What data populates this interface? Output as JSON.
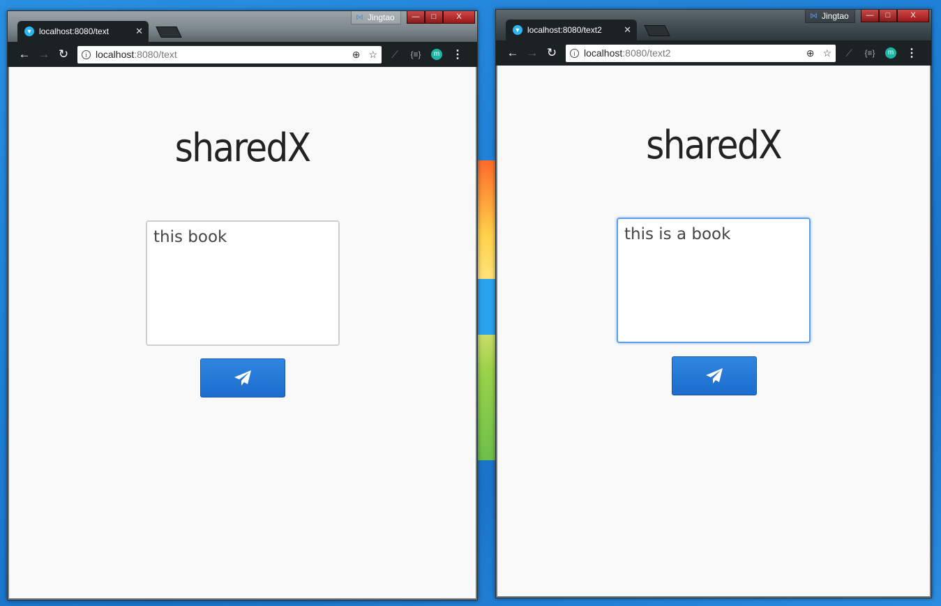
{
  "windows": [
    {
      "id": "left",
      "profile_name": "Jingtao",
      "tab_title": "localhost:8080/text",
      "url_host": "localhost",
      "url_path": ":8080/text",
      "brand_title": "sharedX",
      "textarea_value": "this book",
      "textarea_focused": false
    },
    {
      "id": "right",
      "profile_name": "Jingtao",
      "tab_title": "localhost:8080/text2",
      "url_host": "localhost",
      "url_path": ":8080/text2",
      "brand_title": "sharedX",
      "textarea_value": "this is a book",
      "textarea_focused": true
    }
  ],
  "icons": {
    "back": "back-arrow-icon",
    "forward": "forward-arrow-icon",
    "reload": "reload-icon",
    "info": "info-icon",
    "zoom": "zoom-icon",
    "bookmark": "star-icon",
    "send": "paper-plane-icon"
  },
  "colors": {
    "send_button": "#1c6dcc",
    "focus_ring": "#5b9de8",
    "window_close": "#9b1717"
  }
}
